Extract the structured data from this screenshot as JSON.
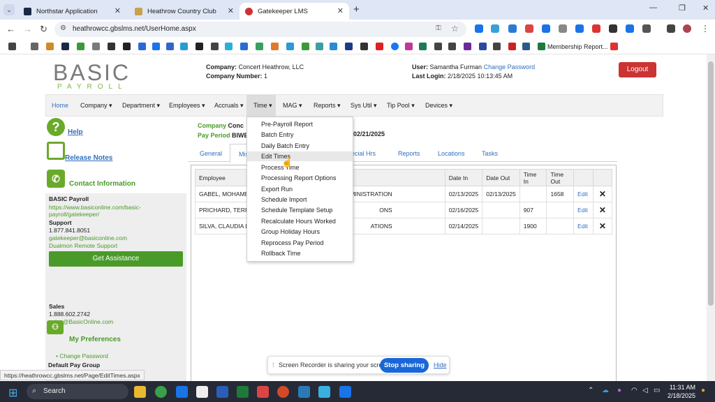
{
  "browser": {
    "tabs": [
      {
        "title": "Northstar Application",
        "color": "#1b2a44"
      },
      {
        "title": "Heathrow Country Club",
        "color": "#c8a24a"
      },
      {
        "title": "Gatekeeper LMS",
        "color": "#cc3333"
      }
    ],
    "url": "heathrowcc.gbslms.net/UserHome.aspx",
    "bookmark_label": "Membership Report...",
    "status_url": "https://heathrowcc.gbslms.net/Page/EditTimes.aspx"
  },
  "header": {
    "logo_main": "BASIC",
    "logo_sub": "PAYROLL",
    "company_label": "Company:",
    "company_name": "Concert Heathrow, LLC",
    "company_number_label": "Company Number:",
    "company_number": "1",
    "user_label": "User:",
    "user_name": "Samantha Furman",
    "change_password": "Change Password",
    "last_login_label": "Last Login:",
    "last_login": "2/18/2025 10:13:45 AM",
    "logout": "Logout"
  },
  "menu": {
    "home": "Home",
    "items": [
      "Company",
      "Department",
      "Employees",
      "Accruals",
      "Time",
      "MAG",
      "Reports",
      "Sys Util",
      "Tip Pool",
      "Devices"
    ]
  },
  "dropdown": {
    "items": [
      "Pre-Payroll Report",
      "Batch Entry",
      "Daily Batch Entry",
      "Edit Times",
      "Process Time",
      "Processing Report Options",
      "Export Run",
      "Schedule Import",
      "Schedule Template Setup",
      "Recalculate Hours Worked",
      "Group Holiday Hours",
      "Reprocess Pay Period",
      "Rollback Time"
    ]
  },
  "sidebar": {
    "help": "Help",
    "release_notes": "Release Notes",
    "contact_info": "Contact Information",
    "basic_payroll": "BASIC Payroll",
    "basic_url": "https://www.basiconline.com/basic-payroll/gatekeeper/",
    "support": "Support",
    "support_phone": "1.877.841.8051",
    "support_email": "gatekeeper@basiconline.com",
    "remote_support": "Dualmon Remote Support",
    "get_assistance": "Get Assistance",
    "sales": "Sales",
    "sales_phone": "1.888.602.2742",
    "sales_email": "sales@BasicOnline.com",
    "my_preferences": "My Preferences",
    "change_password": "Change Password",
    "default_pay_group": "Default Pay Group"
  },
  "filters": {
    "company_label": "Company",
    "company_value": "Conc",
    "pay_period_label": "Pay Period",
    "pay_period_value": "BIWE",
    "pay_period_end": "02/21/2025"
  },
  "subtabs": [
    "General",
    "Mis",
    "pecial Hrs",
    "Reports",
    "Locations",
    "Tasks"
  ],
  "table": {
    "headers": [
      "Employee",
      "",
      "Date In",
      "Date Out",
      "Time In",
      "Time Out",
      "",
      ""
    ],
    "rows": [
      {
        "employee": "GABEL, MOHAMED",
        "dept": "DMINISTRATION",
        "date_in": "02/13/2025",
        "date_out": "02/13/2025",
        "time_in": "",
        "time_out": "1658",
        "edit": "Edit"
      },
      {
        "employee": "PRICHARD, TERRA",
        "dept": "ONS",
        "date_in": "02/16/2025",
        "date_out": "",
        "time_in": "907",
        "time_out": "",
        "edit": "Edit"
      },
      {
        "employee": "SILVA, CLAUDIA L",
        "dept": "ATIONS",
        "date_in": "02/14/2025",
        "date_out": "",
        "time_in": "1900",
        "time_out": "",
        "edit": "Edit"
      }
    ]
  },
  "recorder": {
    "message": "Screen Recorder is sharing your screen.",
    "stop": "Stop sharing",
    "hide": "Hide"
  },
  "taskbar": {
    "search": "Search",
    "time": "11:31 AM",
    "date": "2/18/2025"
  }
}
